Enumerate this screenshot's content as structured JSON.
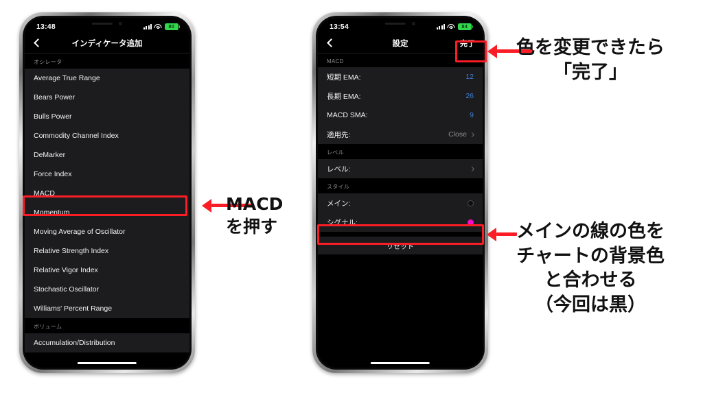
{
  "left_phone": {
    "status": {
      "time": "13:48",
      "battery": "80",
      "signal_icon": "cellular-bars-icon",
      "wifi_icon": "wifi-icon",
      "battery_icon": "battery-icon"
    },
    "nav": {
      "back_icon": "back-chevron-icon",
      "title": "インディケータ追加"
    },
    "sections": [
      {
        "header": "オシレータ",
        "items": [
          "Average True Range",
          "Bears Power",
          "Bulls Power",
          "Commodity Channel Index",
          "DeMarker",
          "Force Index",
          "MACD",
          "Momentum",
          "Moving Average of Oscillator",
          "Relative Strength Index",
          "Relative Vigor Index",
          "Stochastic Oscillator",
          "Williams' Percent Range"
        ]
      },
      {
        "header": "ボリューム",
        "items": [
          "Accumulation/Distribution"
        ]
      }
    ]
  },
  "right_phone": {
    "status": {
      "time": "13:54",
      "battery": "84",
      "signal_icon": "cellular-bars-icon",
      "wifi_icon": "wifi-icon",
      "battery_icon": "battery-icon"
    },
    "nav": {
      "back_icon": "back-chevron-icon",
      "title": "設定",
      "done_label": "完了"
    },
    "sections": [
      {
        "header": "MACD",
        "rows": [
          {
            "label": "短期 EMA:",
            "value": "12",
            "kind": "number"
          },
          {
            "label": "長期 EMA:",
            "value": "26",
            "kind": "number"
          },
          {
            "label": "MACD SMA:",
            "value": "9",
            "kind": "number"
          },
          {
            "label": "適用先:",
            "value": "Close",
            "kind": "disclosure"
          }
        ]
      },
      {
        "header": "レベル",
        "rows": [
          {
            "label": "レベル:",
            "value": "",
            "kind": "disclosure"
          }
        ]
      },
      {
        "header": "スタイル",
        "rows": [
          {
            "label": "メイン:",
            "value": "",
            "kind": "color",
            "color": "#0d0d0d"
          },
          {
            "label": "シグナル:",
            "value": "",
            "kind": "color",
            "color": "#f20dc6"
          }
        ]
      }
    ],
    "reset_label": "リセット"
  },
  "annotations": {
    "accent_color": "#fb1d26",
    "macd_tap": "MACD\nを押す",
    "done_tap": "色を変更できたら\n「完了」",
    "main_color_note": "メインの線の色を\nチャートの背景色\nと合わせる\n（今回は黒）"
  }
}
